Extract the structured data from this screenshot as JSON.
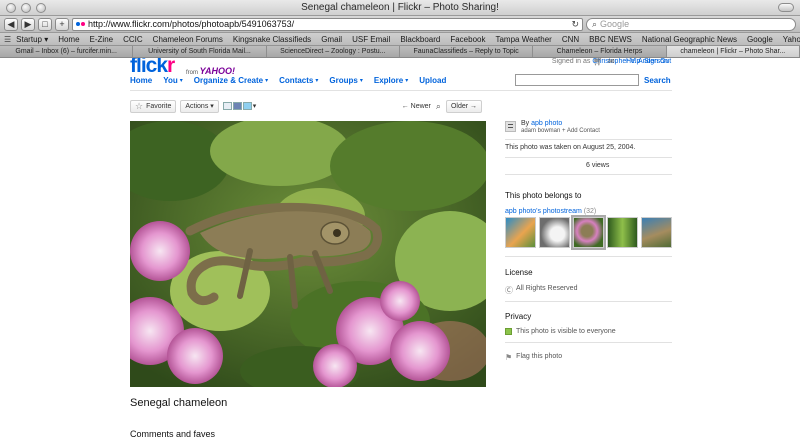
{
  "window": {
    "title": "Senegal chameleon | Flickr – Photo Sharing!"
  },
  "toolbar": {
    "back": "◀",
    "forward": "▶",
    "bookmarks_btn": "□",
    "add_btn": "+",
    "url": "http://www.flickr.com/photos/photoapb/5491063753/",
    "search_placeholder": "Google"
  },
  "bookmarks_bar": [
    "Startup ▾",
    "Home",
    "E-Zine",
    "CCIC",
    "Chameleon Forums",
    "Kingsnake Classifieds",
    "Gmail",
    "USF Email",
    "Blackboard",
    "Facebook",
    "Tampa Weather",
    "CNN",
    "BBC NEWS",
    "National Geographic News",
    "Google",
    "Yahoo!"
  ],
  "tabs": [
    {
      "label": "Gmail – Inbox (6) – furcifer.min...",
      "active": false
    },
    {
      "label": "University of South Florida Mail...",
      "active": false
    },
    {
      "label": "ScienceDirect – Zoology : Postu...",
      "active": false
    },
    {
      "label": "FaunaClassifieds – Reply to Topic",
      "active": false
    },
    {
      "label": "Chameleon – Florida Herps",
      "active": false
    },
    {
      "label": "chameleon | Flickr – Photo Shar...",
      "active": true
    }
  ],
  "header": {
    "logo_f": "flick",
    "logo_r": "r",
    "from": "from",
    "yahoo": "YAHOO!",
    "signed_in_as": "Signed in as",
    "user_name": "Christopher V. Anderson",
    "help": "Help",
    "sign_out": "Sign Out",
    "search_label": "Search"
  },
  "nav": [
    {
      "label": "Home",
      "caret": false
    },
    {
      "label": "You",
      "caret": true
    },
    {
      "label": "Organize & Create",
      "caret": true
    },
    {
      "label": "Contacts",
      "caret": true
    },
    {
      "label": "Groups",
      "caret": true
    },
    {
      "label": "Explore",
      "caret": true
    },
    {
      "label": "Upload",
      "caret": false
    }
  ],
  "actions": {
    "favorite": "Favorite",
    "actions": "Actions ▾",
    "share_caret": "▾",
    "newer": "← Newer",
    "older": "Older →"
  },
  "photo": {
    "title": "Senegal chameleon",
    "comments_heading": "Comments and faves"
  },
  "sidebar": {
    "by": "By",
    "owner_link": "apb photo",
    "owner_name": "adam bowman",
    "add_contact": "+ Add Contact",
    "taken": "This photo was taken on August 25, 2004.",
    "views": "6 views",
    "belongs": "This photo belongs to",
    "stream": "apb photo's photostream",
    "stream_count": "(32)",
    "license_heading": "License",
    "license_value": "All Rights Reserved",
    "privacy_heading": "Privacy",
    "privacy_value": "This photo is visible to everyone",
    "flag": "Flag this photo"
  },
  "colors": {
    "flickr_blue": "#0063dc",
    "flickr_pink": "#ff0084",
    "yahoo_purple": "#7b0099"
  }
}
